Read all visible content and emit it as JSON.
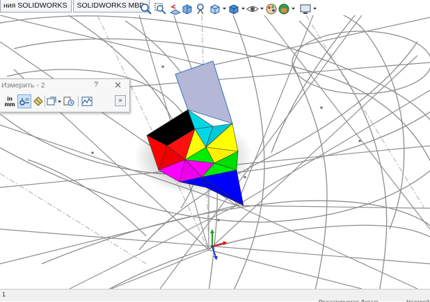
{
  "tabs": [
    {
      "label": "ния SOLIDWORKS"
    },
    {
      "label": "SOLIDWORKS MBD"
    }
  ],
  "hud_icons": [
    "zoom-to-fit-icon",
    "zoom-area-icon",
    "previous-view-icon",
    "section-view-icon",
    "dynamic-annotation-icon",
    "view-orientation-icon",
    "display-style-icon",
    "hide-show-items-icon",
    "edit-appearance-icon",
    "apply-scene-icon",
    "view-settings-icon"
  ],
  "measure_panel": {
    "title": "Измерить - 2",
    "help": "?",
    "close": "✕",
    "units_top": "in",
    "units_bottom": "mm",
    "expand": "»"
  },
  "statusbar": {
    "page": "1",
    "item_a": "Редактируется Деталь",
    "item_b": "Настрой"
  },
  "colors": {
    "accent": "#7fa9d6",
    "wire": "#8c8c8c",
    "facets": [
      "#b4b8d6",
      "#00d8e8",
      "#ffff00",
      "#000000",
      "#ff0000",
      "#ff00ff",
      "#00ee00",
      "#0000ff"
    ]
  }
}
